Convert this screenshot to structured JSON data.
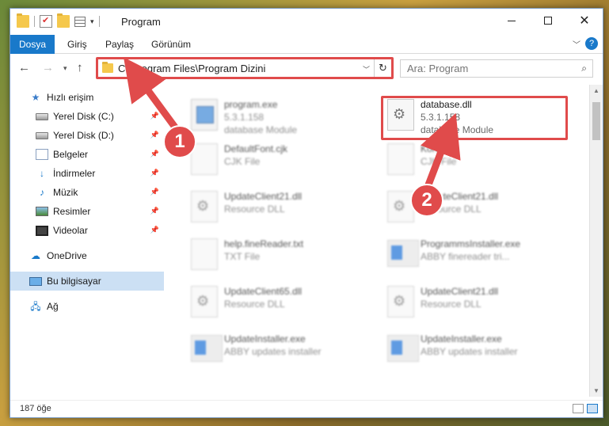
{
  "window": {
    "title": "Program"
  },
  "ribbon": {
    "tabs": [
      "Dosya",
      "Giriş",
      "Paylaş",
      "Görünüm"
    ]
  },
  "address": {
    "path": "C:\\Program Files\\Program Dizini"
  },
  "search": {
    "placeholder": "Ara: Program"
  },
  "sidebar": {
    "items": [
      {
        "label": "Hızlı erişim",
        "icon": "star-icon"
      },
      {
        "label": "Yerel Disk (C:)",
        "icon": "drive-icon"
      },
      {
        "label": "Yerel Disk (D:)",
        "icon": "drive-icon"
      },
      {
        "label": "Belgeler",
        "icon": "documents-icon"
      },
      {
        "label": "İndirmeler",
        "icon": "download-icon"
      },
      {
        "label": "Müzik",
        "icon": "music-icon"
      },
      {
        "label": "Resimler",
        "icon": "pictures-icon"
      },
      {
        "label": "Videolar",
        "icon": "videos-icon"
      },
      {
        "label": "OneDrive",
        "icon": "cloud-icon"
      },
      {
        "label": "Bu bilgisayar",
        "icon": "computer-icon"
      },
      {
        "label": "Ağ",
        "icon": "network-icon"
      }
    ]
  },
  "files": [
    {
      "name": "program.exe",
      "line2": "5.3.1.158",
      "line3": "database Module"
    },
    {
      "name": "database.dll",
      "line2": "5.3.1.158",
      "line3": "database Module"
    },
    {
      "name": "DefaultFont.cjk",
      "line2": "CJK File"
    },
    {
      "name": "Kore.cjk",
      "line2": "CJK File"
    },
    {
      "name": "UpdateClient21.dll",
      "line2": "Resource DLL"
    },
    {
      "name": "UpdateClient21.dll",
      "line2": "Resource DLL"
    },
    {
      "name": "help.fineReader.txt",
      "line2": "TXT File"
    },
    {
      "name": "ProgrammsInstaller.exe",
      "line2": "ABBY finereader tri..."
    },
    {
      "name": "UpdateClient65.dll",
      "line2": "Resource DLL"
    },
    {
      "name": "UpdateClient21.dll",
      "line2": "Resource DLL"
    },
    {
      "name": "UpdateInstaller.exe",
      "line2": "ABBY updates installer"
    },
    {
      "name": "UpdateInstaller.exe",
      "line2": "ABBY updates installer"
    }
  ],
  "status": {
    "count": "187 öğe"
  },
  "annotations": {
    "badge1": "1",
    "badge2": "2",
    "color": "#e04b4b"
  }
}
